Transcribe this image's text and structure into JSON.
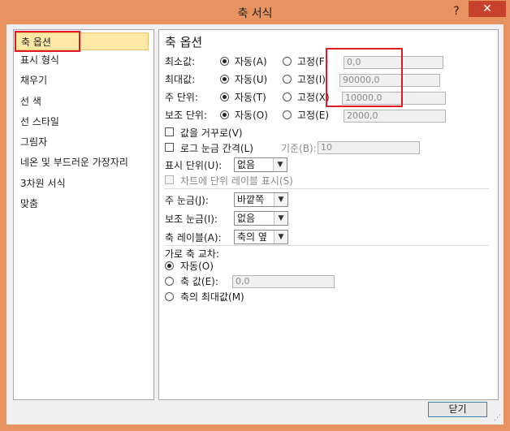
{
  "window": {
    "title": "축 서식",
    "help_icon": "?",
    "close_icon": "✕"
  },
  "sidebar": {
    "items": [
      {
        "label": "축 옵션"
      },
      {
        "label": "표시 형식"
      },
      {
        "label": "채우기"
      },
      {
        "label": "선 색"
      },
      {
        "label": "선 스타일"
      },
      {
        "label": "그림자"
      },
      {
        "label": "네온 및 부드러운 가장자리"
      },
      {
        "label": "3차원 서식"
      },
      {
        "label": "맞춤"
      }
    ]
  },
  "panel": {
    "title": "축 옵션",
    "rows": [
      {
        "label": "최소값:",
        "auto": "자동(A)",
        "fixed": "고정(F)",
        "value": "0,0",
        "auto_selected": true
      },
      {
        "label": "최대값:",
        "auto": "자동(U)",
        "fixed": "고정(I)",
        "value": "90000,0",
        "auto_selected": true
      },
      {
        "label": "주 단위:",
        "auto": "자동(T)",
        "fixed": "고정(X)",
        "value": "10000,0",
        "auto_selected": true
      },
      {
        "label": "보조 단위:",
        "auto": "자동(O)",
        "fixed": "고정(E)",
        "value": "2000,0",
        "auto_selected": true
      }
    ],
    "reverse_label": "값을 거꾸로(V)",
    "log_label": "로그 눈금 간격(L)",
    "base_label": "기준(B):",
    "base_value": "10",
    "display_units_label": "표시 단위(U):",
    "display_units_value": "없음",
    "show_units_label": "차트에 단위 레이블 표시(S)",
    "major_tick_label": "주 눈금(J):",
    "major_tick_value": "바깥쪽",
    "minor_tick_label": "보조 눈금(I):",
    "minor_tick_value": "없음",
    "axis_labels_label": "축 레이블(A):",
    "axis_labels_value": "축의 옆",
    "cross_title": "가로 축 교차:",
    "cross_auto": "자동(O)",
    "cross_value_label": "축 값(E):",
    "cross_value": "0,0",
    "cross_max": "축의 최대값(M)"
  },
  "footer": {
    "close_label": "닫기"
  }
}
